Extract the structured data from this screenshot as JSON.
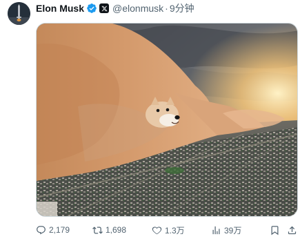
{
  "author": {
    "name": "Elon Musk",
    "handle": "@elonmusk",
    "time": "9分钟",
    "separator": "·"
  },
  "media": {
    "description_icon": "doge-dust-storm-image"
  },
  "actions": {
    "reply_count": "2,179",
    "retweet_count": "1,698",
    "like_count": "1.3万",
    "view_count": "39万"
  },
  "colors": {
    "verified_blue": "#1d9bf0",
    "text_primary": "#0f1419",
    "text_secondary": "#536471"
  }
}
